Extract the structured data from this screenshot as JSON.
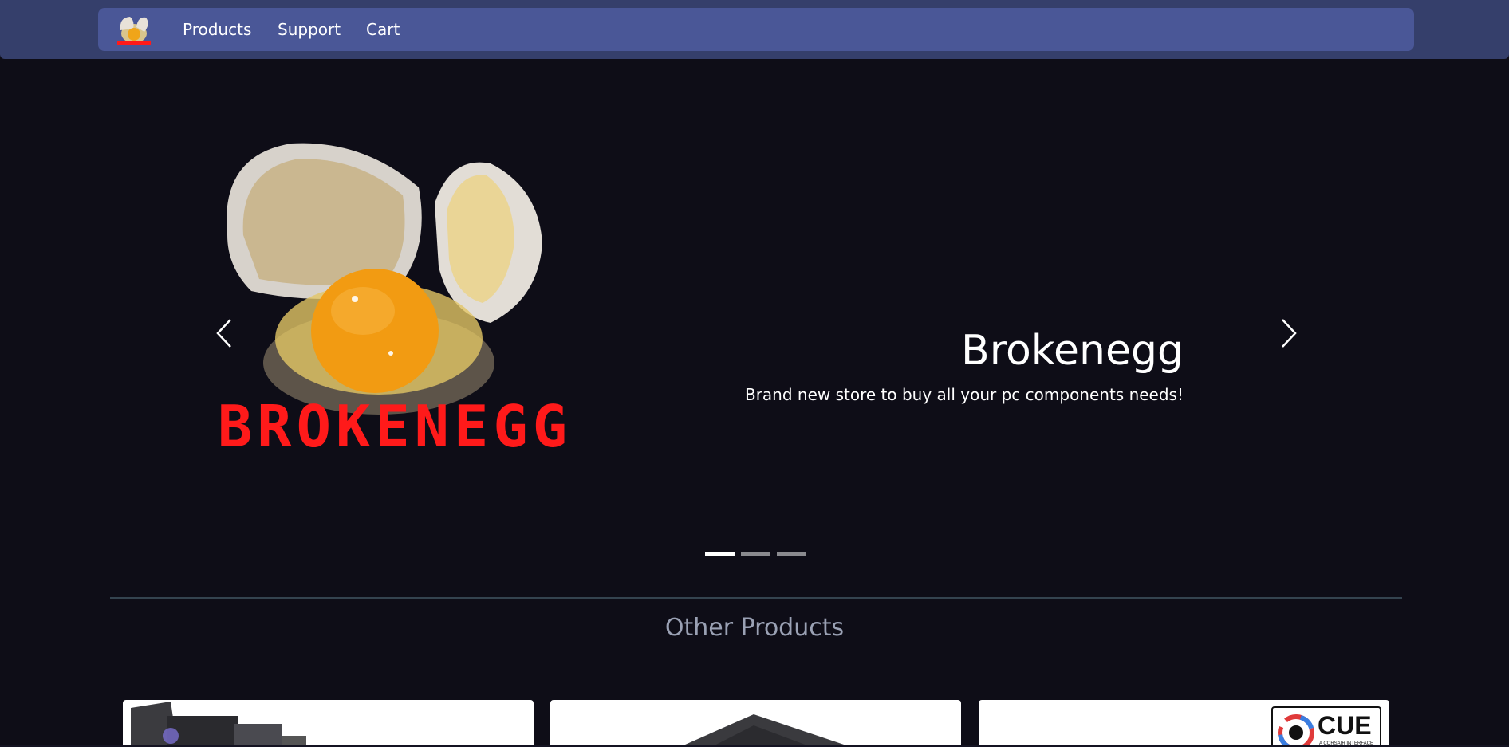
{
  "nav": {
    "logo_alt": "Brokenegg",
    "links": [
      "Products",
      "Support",
      "Cart"
    ]
  },
  "carousel": {
    "logo_text": "BROKENEGG",
    "title": "Brokenegg",
    "caption": "Brand new store to buy all your pc components needs!",
    "active_index": 0,
    "slide_count": 3
  },
  "section": {
    "title": "Other Products"
  },
  "cards": [
    {
      "image": "motherboard-image"
    },
    {
      "image": "power-supply-image"
    },
    {
      "image": "icue-logo-image",
      "badge_text": "CUE",
      "badge_sub": "A CORSAIR INTERFACE"
    }
  ],
  "colors": {
    "background": "#0e0d17",
    "header": "#353f6b",
    "navbar": "#4a5797",
    "brand_red": "#ff1a1a",
    "section_title": "#9aa1b4"
  }
}
